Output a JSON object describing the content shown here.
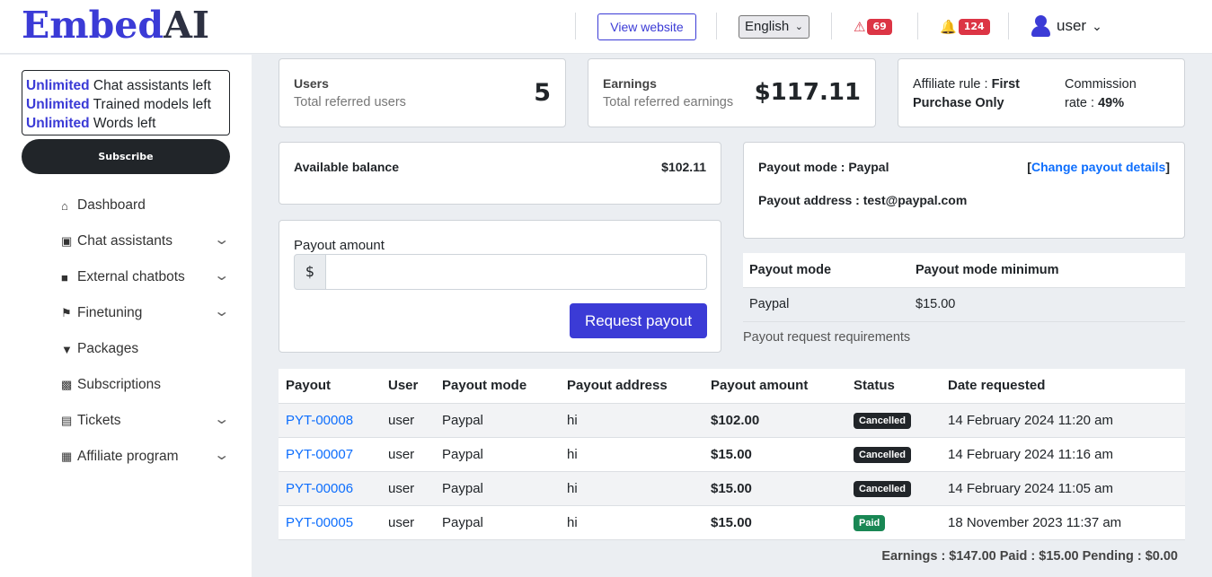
{
  "brand": {
    "name_main": "Embed",
    "name_suffix": "AI"
  },
  "header": {
    "view_website": "View website",
    "language": "English",
    "alerts_count": "69",
    "notifications_count": "124",
    "user_name": "user"
  },
  "sidebar": {
    "limits": [
      {
        "strong": "Unlimited",
        "text": " Chat assistants left"
      },
      {
        "strong": "Unlimited",
        "text": " Trained models left"
      },
      {
        "strong": "Unlimited",
        "text": " Words left"
      }
    ],
    "subscribe": "Subscribe",
    "items": [
      {
        "label": "Dashboard",
        "icon": "home-icon",
        "expandable": false
      },
      {
        "label": "Chat assistants",
        "icon": "chip-icon",
        "expandable": true
      },
      {
        "label": "External chatbots",
        "icon": "comment-icon",
        "expandable": true
      },
      {
        "label": "Finetuning",
        "icon": "flag-icon",
        "expandable": true
      },
      {
        "label": "Packages",
        "icon": "filter-icon",
        "expandable": false
      },
      {
        "label": "Subscriptions",
        "icon": "money-icon",
        "expandable": false
      },
      {
        "label": "Tickets",
        "icon": "inbox-icon",
        "expandable": true
      },
      {
        "label": "Affiliate program",
        "icon": "gift-icon",
        "expandable": true
      }
    ]
  },
  "stats": {
    "users": {
      "label": "Users",
      "sub": "Total referred users",
      "value": "5"
    },
    "earnings": {
      "label": "Earnings",
      "sub": "Total referred earnings",
      "value": "$117.11"
    },
    "affiliate": {
      "rule_label": "Affiliate rule : ",
      "rule_value_1": "First",
      "rule_value_2": "Purchase Only",
      "commission_label_1": "Commission",
      "commission_label_2": "rate : ",
      "commission_value": "49%"
    }
  },
  "balance": {
    "label": "Available balance",
    "value": "$102.11"
  },
  "payout_form": {
    "label": "Payout amount",
    "currency": "$",
    "value": "",
    "placeholder": "",
    "button": "Request payout"
  },
  "payout_info": {
    "mode_label": "Payout mode : Paypal",
    "change_link": "Change payout details",
    "address_label": "Payout address : test@paypal.com"
  },
  "mode_table": {
    "headers": [
      "Payout mode",
      "Payout mode minimum"
    ],
    "rows": [
      [
        "Paypal",
        "$15.00"
      ]
    ],
    "caption": "Payout request requirements"
  },
  "payout_table": {
    "headers": [
      "Payout",
      "User",
      "Payout mode",
      "Payout address",
      "Payout amount",
      "Status",
      "Date requested"
    ],
    "rows": [
      {
        "id": "PYT-00008",
        "user": "user",
        "mode": "Paypal",
        "address": "hi",
        "amount": "$102.00",
        "status": "Cancelled",
        "date": "14 February 2024 11:20 am"
      },
      {
        "id": "PYT-00007",
        "user": "user",
        "mode": "Paypal",
        "address": "hi",
        "amount": "$15.00",
        "status": "Cancelled",
        "date": "14 February 2024 11:16 am"
      },
      {
        "id": "PYT-00006",
        "user": "user",
        "mode": "Paypal",
        "address": "hi",
        "amount": "$15.00",
        "status": "Cancelled",
        "date": "14 February 2024 11:05 am"
      },
      {
        "id": "PYT-00005",
        "user": "user",
        "mode": "Paypal",
        "address": "hi",
        "amount": "$15.00",
        "status": "Paid",
        "date": "18 November 2023 11:37 am"
      }
    ],
    "summary": "Earnings : $147.00 Paid : $15.00 Pending : $0.00"
  },
  "colors": {
    "accent": "#3b3bd6",
    "link": "#0d6efd",
    "danger": "#dc3545",
    "paid": "#198754",
    "dark": "#212529"
  }
}
